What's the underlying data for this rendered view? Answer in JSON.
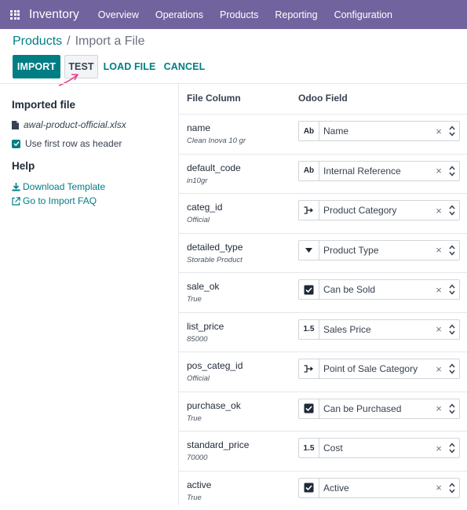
{
  "navbar": {
    "app_name": "Inventory",
    "menu": [
      "Overview",
      "Operations",
      "Products",
      "Reporting",
      "Configuration"
    ]
  },
  "breadcrumb": {
    "parent": "Products",
    "separator": "/",
    "current": "Import a File"
  },
  "buttons": {
    "import": "IMPORT",
    "test": "TEST",
    "load_file": "LOAD FILE",
    "cancel": "CANCEL"
  },
  "sidebar": {
    "imported_heading": "Imported file",
    "file_name": "awal-product-official.xlsx",
    "header_option": "Use first row as header",
    "header_checked": true,
    "help_heading": "Help",
    "download_template": "Download Template",
    "import_faq": "Go to Import FAQ"
  },
  "table": {
    "col_file": "File Column",
    "col_odoo": "Odoo Field",
    "rows": [
      {
        "column": "name",
        "sample": "Clean Inova 10 gr",
        "type_icon": "text-type-icon",
        "type_label": "Ab",
        "field": "Name"
      },
      {
        "column": "default_code",
        "sample": "in10gr",
        "type_icon": "text-type-icon",
        "type_label": "Ab",
        "field": "Internal Reference"
      },
      {
        "column": "categ_id",
        "sample": "Official",
        "type_icon": "relation-icon",
        "type_label": "",
        "field": "Product Category"
      },
      {
        "column": "detailed_type",
        "sample": "Storable Product",
        "type_icon": "selection-icon",
        "type_label": "",
        "field": "Product Type"
      },
      {
        "column": "sale_ok",
        "sample": "True",
        "type_icon": "boolean-icon",
        "type_label": "",
        "field": "Can be Sold"
      },
      {
        "column": "list_price",
        "sample": "85000",
        "type_icon": "float-type-icon",
        "type_label": "1.5",
        "field": "Sales Price"
      },
      {
        "column": "pos_categ_id",
        "sample": "Official",
        "type_icon": "relation-icon",
        "type_label": "",
        "field": "Point of Sale Category"
      },
      {
        "column": "purchase_ok",
        "sample": "True",
        "type_icon": "boolean-icon",
        "type_label": "",
        "field": "Can be Purchased"
      },
      {
        "column": "standard_price",
        "sample": "70000",
        "type_icon": "float-type-icon",
        "type_label": "1.5",
        "field": "Cost"
      },
      {
        "column": "active",
        "sample": "True",
        "type_icon": "boolean-icon",
        "type_label": "",
        "field": "Active"
      }
    ]
  },
  "colors": {
    "navbar": "#71639e",
    "primary": "#017e84",
    "annotation_arrow": "#e83e8c"
  }
}
